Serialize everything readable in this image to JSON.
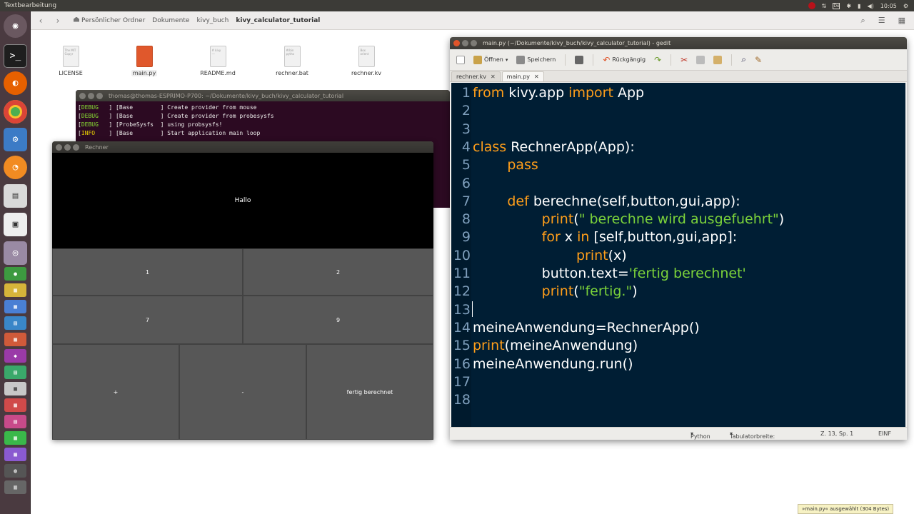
{
  "top_panel": {
    "title": "Textbearbeitung",
    "clock": "10:05",
    "kbd": "De"
  },
  "file_manager": {
    "breadcrumbs": [
      "Persönlicher Ordner",
      "Dokumente",
      "kivy_buch",
      "kivy_calculator_tutorial"
    ],
    "files": [
      {
        "name": "LICENSE",
        "type": "text"
      },
      {
        "name": "main.py",
        "type": "python",
        "selected": true
      },
      {
        "name": "README.md",
        "type": "text"
      },
      {
        "name": "rechner.bat",
        "type": "text"
      },
      {
        "name": "rechner.kv",
        "type": "text"
      }
    ]
  },
  "terminal": {
    "title": "thomas@thomas-ESPRIMO-P700: ~/Dokumente/kivy_buch/kivy_calculator_tutorial",
    "lines": [
      {
        "level": "DEBUG",
        "module": "Base",
        "text": "Create provider from mouse"
      },
      {
        "level": "DEBUG",
        "module": "Base",
        "text": "Create provider from probesysfs"
      },
      {
        "level": "DEBUG",
        "module": "ProbeSysfs",
        "text": "using probsysfs!"
      },
      {
        "level": "INFO",
        "module": "Base",
        "text": "Start application main loop"
      }
    ]
  },
  "kivy_app": {
    "title": "Rechner",
    "label": "Hallo",
    "buttons": [
      "1",
      "2",
      "7",
      "9",
      "+",
      "-",
      "fertig berechnet"
    ]
  },
  "gedit": {
    "title": "main.py (~/Dokumente/kivy_buch/kivy_calculator_tutorial) - gedit",
    "toolbar": {
      "open": "Öffnen",
      "save": "Speichern",
      "undo": "Rückgängig"
    },
    "tabs": [
      {
        "label": "rechner.kv",
        "active": false
      },
      {
        "label": "main.py",
        "active": true
      }
    ],
    "code_lines": [
      "from kivy.app import App",
      "",
      "",
      "class RechnerApp(App):",
      "        pass",
      "",
      "        def berechne(self,button,gui,app):",
      "                print(\" berechne wird ausgefuehrt\")",
      "                for x in [self,button,gui,app]:",
      "                        print(x)",
      "                button.text='fertig berechnet'",
      "                print(\"fertig.\")",
      "",
      "meineAnwendung=RechnerApp()",
      "print(meineAnwendung)",
      "meineAnwendung.run()",
      "",
      ""
    ],
    "status": {
      "language": "Python",
      "tab_width": "Tabulatorbreite: 8",
      "position": "Z. 13, Sp. 1",
      "mode": "EINF"
    }
  },
  "toast": "»main.py« ausgewählt (304 Bytes)"
}
